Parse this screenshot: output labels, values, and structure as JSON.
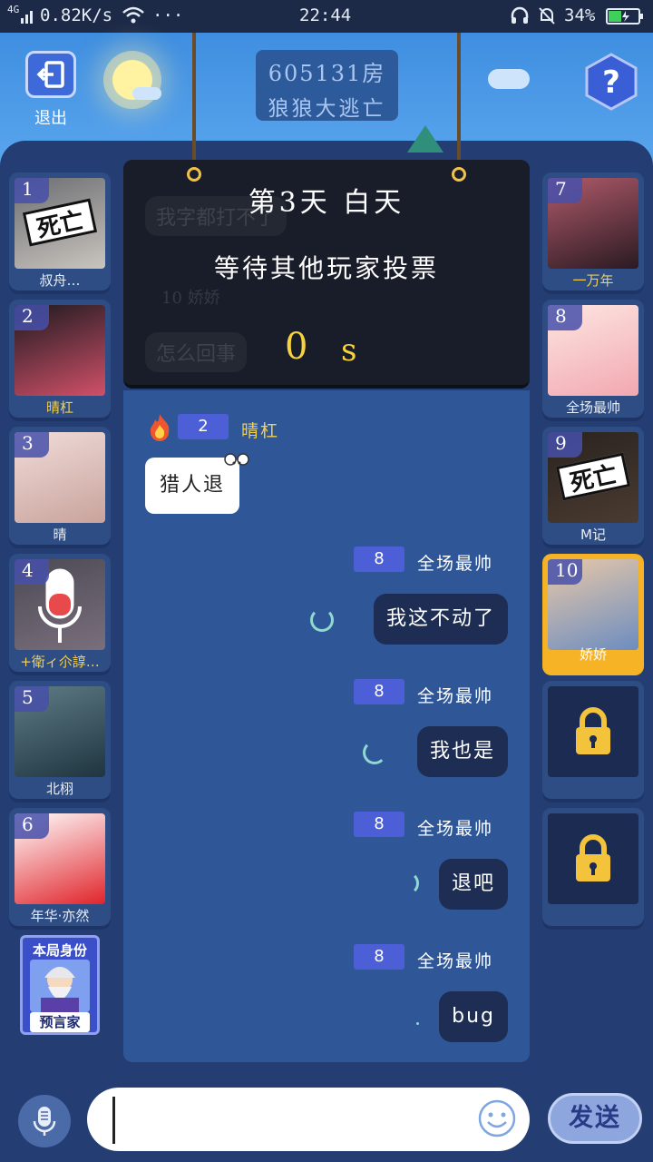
{
  "status_bar": {
    "network": "4G",
    "speed": "0.82K/s",
    "more": "···",
    "time": "22:44",
    "battery": "34%"
  },
  "header": {
    "exit_label": "退出",
    "room_number": "605131房",
    "game_name": "狼狼大逃亡",
    "help_icon": "?"
  },
  "announcement": {
    "day": "第3天  白天",
    "status": "等待其他玩家投票",
    "countdown": "0",
    "unit": "s"
  },
  "ghost_messages": [
    "我字都打不了",
    "10  娇娇",
    "怎么回事"
  ],
  "players_left": [
    {
      "num": "1",
      "name": "叔舟…",
      "dead": true,
      "colors": [
        "#6c6e73",
        "#c9c4bd"
      ]
    },
    {
      "num": "2",
      "name": "晴杠",
      "dead": false,
      "gold": true,
      "colors": [
        "#1c1a20",
        "#d15068"
      ]
    },
    {
      "num": "3",
      "name": "晴",
      "dead": false,
      "colors": [
        "#f0dcd9",
        "#c9a39c"
      ]
    },
    {
      "num": "4",
      "name": "+衛ィ尒諄…",
      "dead": false,
      "gold": true,
      "speaking": true,
      "colors": [
        "#4b4a54",
        "#7a6f7c"
      ]
    },
    {
      "num": "5",
      "name": "北栩",
      "dead": false,
      "colors": [
        "#5f7c86",
        "#1f3540"
      ]
    },
    {
      "num": "6",
      "name": "年华·亦然",
      "dead": false,
      "colors": [
        "#ffffff",
        "#e0242a"
      ]
    }
  ],
  "players_right": [
    {
      "num": "7",
      "name": "一万年",
      "dead": false,
      "gold": true,
      "colors": [
        "#b05a6a",
        "#2a1a22"
      ]
    },
    {
      "num": "8",
      "name": "全场最帅",
      "dead": false,
      "colors": [
        "#fde6e2",
        "#f2a8b0"
      ]
    },
    {
      "num": "9",
      "name": "M记",
      "dead": true,
      "colors": [
        "#2a2320",
        "#4a3b30"
      ]
    },
    {
      "num": "10",
      "name": "娇娇",
      "dead": false,
      "selected": true,
      "colors": [
        "#e8c8a8",
        "#6c8dc0"
      ]
    },
    {
      "locked": true
    },
    {
      "locked": true
    }
  ],
  "chat": [
    {
      "side": "left",
      "num": "2",
      "name": "晴杠",
      "text": "猎人退"
    },
    {
      "side": "right",
      "num": "8",
      "name": "全场最帅",
      "text": "我这不动了"
    },
    {
      "side": "right",
      "num": "8",
      "name": "全场最帅",
      "text": "我也是"
    },
    {
      "side": "right",
      "num": "8",
      "name": "全场最帅",
      "text": "退吧"
    },
    {
      "side": "right",
      "num": "8",
      "name": "全场最帅",
      "text": "bug"
    }
  ],
  "role_card": {
    "title": "本局身份",
    "role": "预言家"
  },
  "death_label": "死亡",
  "input": {
    "value": "",
    "placeholder": ""
  },
  "send_label": "发送",
  "accent": {
    "gold": "#f3cf4c",
    "board": "#243e74",
    "chat_bg": "#2f5798"
  }
}
